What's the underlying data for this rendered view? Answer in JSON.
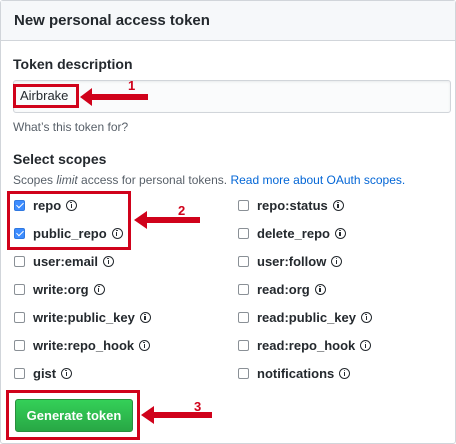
{
  "panel": {
    "title": "New personal access token"
  },
  "token_description": {
    "label": "Token description",
    "value": "Airbrake",
    "note": "What’s this token for?"
  },
  "scopes": {
    "label": "Select scopes",
    "note_prefix": "Scopes ",
    "note_emphasis": "limit",
    "note_suffix": " access for personal tokens.",
    "link_text": "Read more about OAuth scopes.",
    "left": [
      {
        "name": "repo",
        "checked": true
      },
      {
        "name": "public_repo",
        "checked": true
      },
      {
        "name": "user:email",
        "checked": false
      },
      {
        "name": "write:org",
        "checked": false
      },
      {
        "name": "write:public_key",
        "checked": false
      },
      {
        "name": "write:repo_hook",
        "checked": false
      },
      {
        "name": "gist",
        "checked": false
      }
    ],
    "right": [
      {
        "name": "repo:status",
        "checked": false
      },
      {
        "name": "delete_repo",
        "checked": false
      },
      {
        "name": "user:follow",
        "checked": false
      },
      {
        "name": "read:org",
        "checked": false
      },
      {
        "name": "read:public_key",
        "checked": false
      },
      {
        "name": "read:repo_hook",
        "checked": false
      },
      {
        "name": "notifications",
        "checked": false
      }
    ]
  },
  "generate_button": {
    "label": "Generate token"
  },
  "annotations": {
    "step_1": "1",
    "step_2": "2",
    "step_3": "3",
    "color": "#d0021b"
  },
  "colors": {
    "button_green": "#2ea44f",
    "link_blue": "#0366d6",
    "checkbox_blue": "#3c8cff"
  }
}
